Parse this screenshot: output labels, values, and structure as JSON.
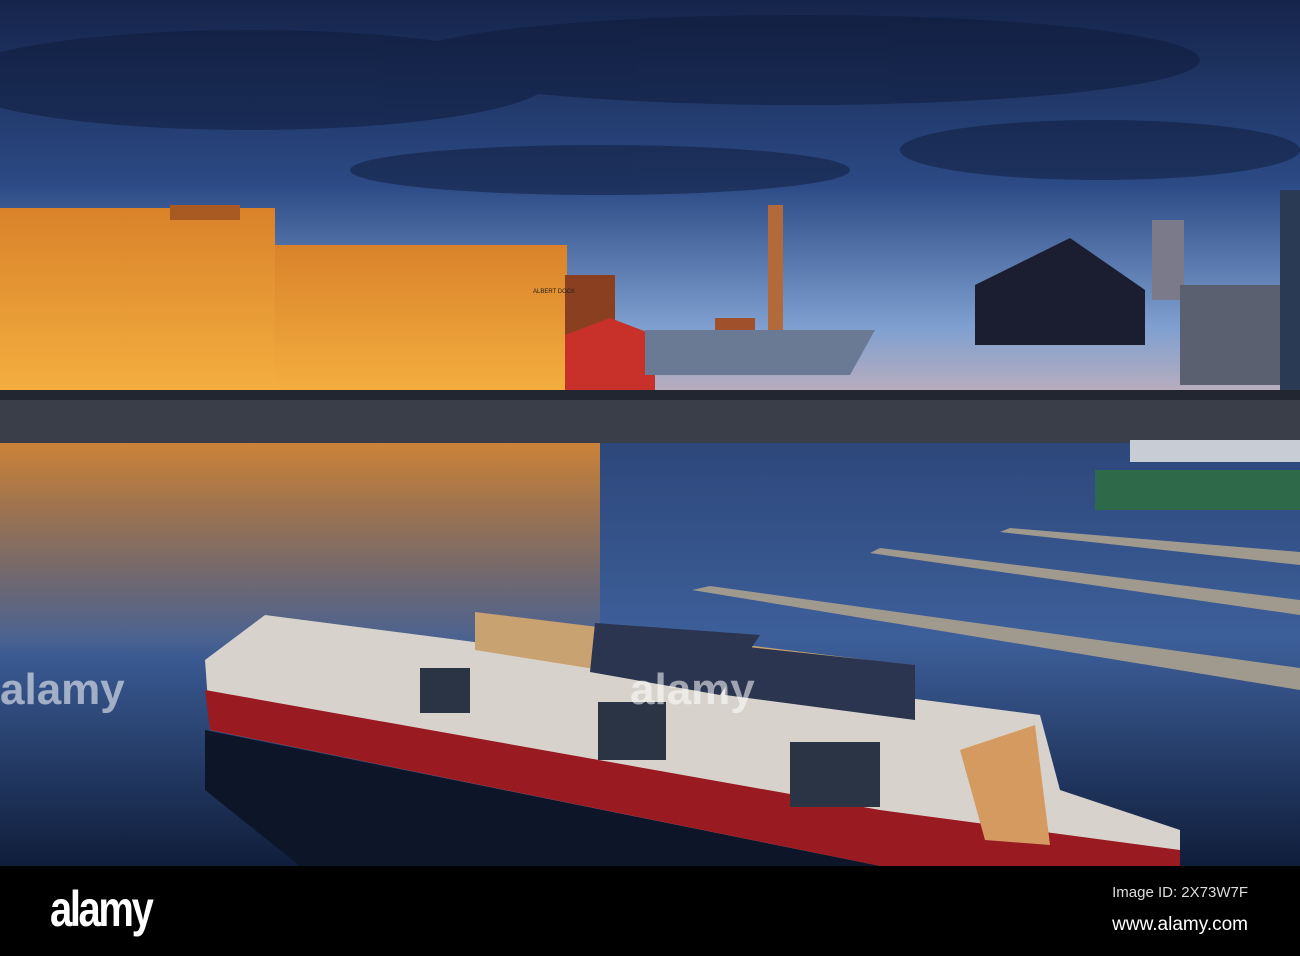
{
  "photo": {
    "scene": "dock-at-dusk",
    "building_sign": "ALBERT DOCK",
    "colors": {
      "sky_top": "#1c2d55",
      "sky_horizon": "#7fa0d0",
      "brick_lit": "#e8962a",
      "red_building": "#c8302a",
      "water": "#1d3560",
      "boat_red": "#9a1a22"
    }
  },
  "watermark": "alamy",
  "footer": {
    "logo": "alamy",
    "image_id": "Image ID: 2X73W7F",
    "site": "www.alamy.com"
  }
}
